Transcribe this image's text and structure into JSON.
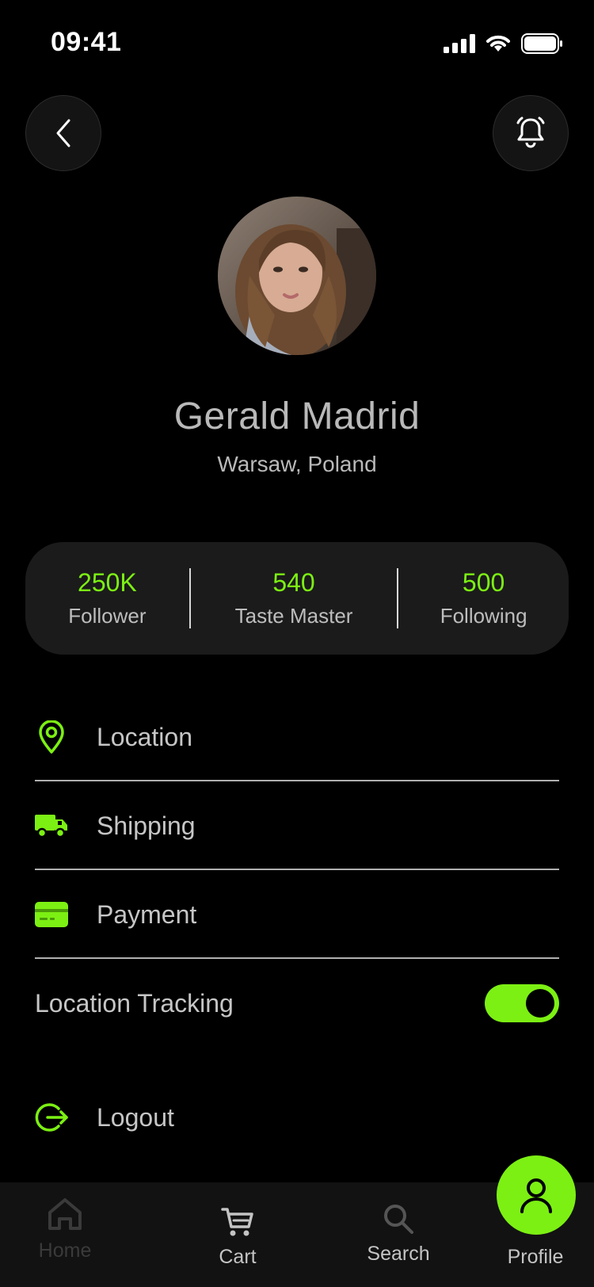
{
  "status": {
    "time": "09:41"
  },
  "profile": {
    "name": "Gerald Madrid",
    "location": "Warsaw, Poland"
  },
  "stats": [
    {
      "value": "250K",
      "label": "Follower"
    },
    {
      "value": "540",
      "label": "Taste Master"
    },
    {
      "value": "500",
      "label": "Following"
    }
  ],
  "menu": {
    "location": "Location",
    "shipping": "Shipping",
    "payment": "Payment",
    "tracking": "Location Tracking",
    "tracking_on": true,
    "logout": "Logout"
  },
  "nav": {
    "home": "Home",
    "cart": "Cart",
    "search": "Search",
    "profile": "Profile",
    "active": "profile"
  },
  "colors": {
    "accent": "#7cf013",
    "background": "#000000",
    "card": "#1b1b1b"
  },
  "icons": {
    "back": "chevron-left-icon",
    "bell": "bell-ringing-icon",
    "location": "map-pin-icon",
    "shipping": "truck-icon",
    "payment": "credit-card-icon",
    "logout": "logout-icon",
    "home": "home-icon",
    "cart": "cart-icon",
    "search": "search-icon",
    "profile": "user-icon"
  }
}
